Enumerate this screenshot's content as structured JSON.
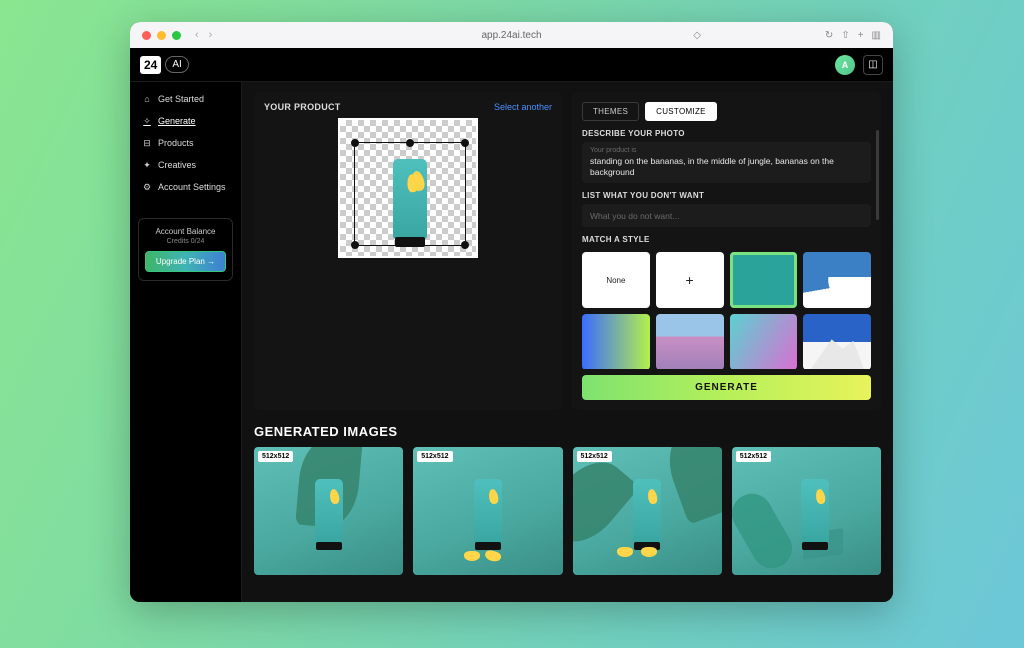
{
  "browser": {
    "url": "app.24ai.tech"
  },
  "header": {
    "logo_primary": "24",
    "logo_secondary": "AI",
    "avatar_initial": "A"
  },
  "sidebar": {
    "items": [
      {
        "icon": "home",
        "label": "Get Started"
      },
      {
        "icon": "wand",
        "label": "Generate"
      },
      {
        "icon": "box",
        "label": "Products"
      },
      {
        "icon": "sparkle",
        "label": "Creatives"
      },
      {
        "icon": "gear",
        "label": "Account Settings"
      }
    ],
    "balance_title": "Account Balance",
    "balance_credits": "Credits 0/24",
    "upgrade_label": "Upgrade Plan →"
  },
  "product_panel": {
    "title": "YOUR PRODUCT",
    "select_another": "Select another"
  },
  "customize_panel": {
    "tabs": {
      "themes": "THEMES",
      "customize": "CUSTOMIZE"
    },
    "describe_label": "DESCRIBE YOUR PHOTO",
    "describe_hint": "Your product is",
    "describe_value": "standing on the bananas, in the middle of jungle, bananas on the background",
    "exclude_label": "LIST WHAT YOU DON'T WANT",
    "exclude_placeholder": "What you do not want...",
    "exclude_value": "",
    "match_label": "MATCH A STYLE",
    "style_none": "None",
    "style_add": "+",
    "generate_label": "GENERATE"
  },
  "generated": {
    "title": "GENERATED IMAGES",
    "badge": "512x512"
  }
}
